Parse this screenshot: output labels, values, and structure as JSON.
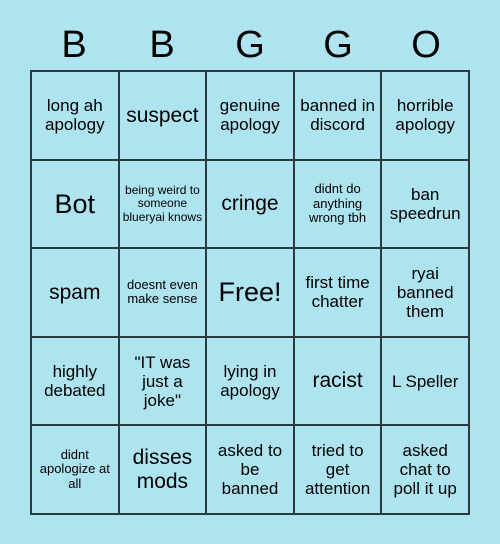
{
  "card": {
    "background_color": "#ade4ef",
    "border_color": "#2c3a3d",
    "text_color": "#000000",
    "headers": [
      "B",
      "B",
      "G",
      "G",
      "O"
    ],
    "rows": [
      [
        {
          "text": "long ah apology",
          "size": "md"
        },
        {
          "text": "suspect",
          "size": "lg"
        },
        {
          "text": "genuine apology",
          "size": "md"
        },
        {
          "text": "banned in discord",
          "size": "md"
        },
        {
          "text": "horrible apology",
          "size": "md"
        }
      ],
      [
        {
          "text": "Bot",
          "size": "xl"
        },
        {
          "text": "being weird to someone blueryai knows",
          "size": "xs"
        },
        {
          "text": "cringe",
          "size": "lg"
        },
        {
          "text": "didnt do anything wrong tbh",
          "size": "sm"
        },
        {
          "text": "ban speedrun",
          "size": "md"
        }
      ],
      [
        {
          "text": "spam",
          "size": "lg"
        },
        {
          "text": "doesnt even make sense",
          "size": "sm"
        },
        {
          "text": "Free!",
          "size": "xl"
        },
        {
          "text": "first time chatter",
          "size": "md"
        },
        {
          "text": "ryai banned them",
          "size": "md"
        }
      ],
      [
        {
          "text": "highly debated",
          "size": "md"
        },
        {
          "text": "\"IT was just a joke\"",
          "size": "md"
        },
        {
          "text": "lying in apology",
          "size": "md"
        },
        {
          "text": "racist",
          "size": "lg"
        },
        {
          "text": "L Speller",
          "size": "md"
        }
      ],
      [
        {
          "text": "didnt apologize at all",
          "size": "sm"
        },
        {
          "text": "disses mods",
          "size": "lg"
        },
        {
          "text": "asked to be banned",
          "size": "md"
        },
        {
          "text": "tried to get attention",
          "size": "md"
        },
        {
          "text": "asked chat to poll it up",
          "size": "md"
        }
      ]
    ]
  }
}
